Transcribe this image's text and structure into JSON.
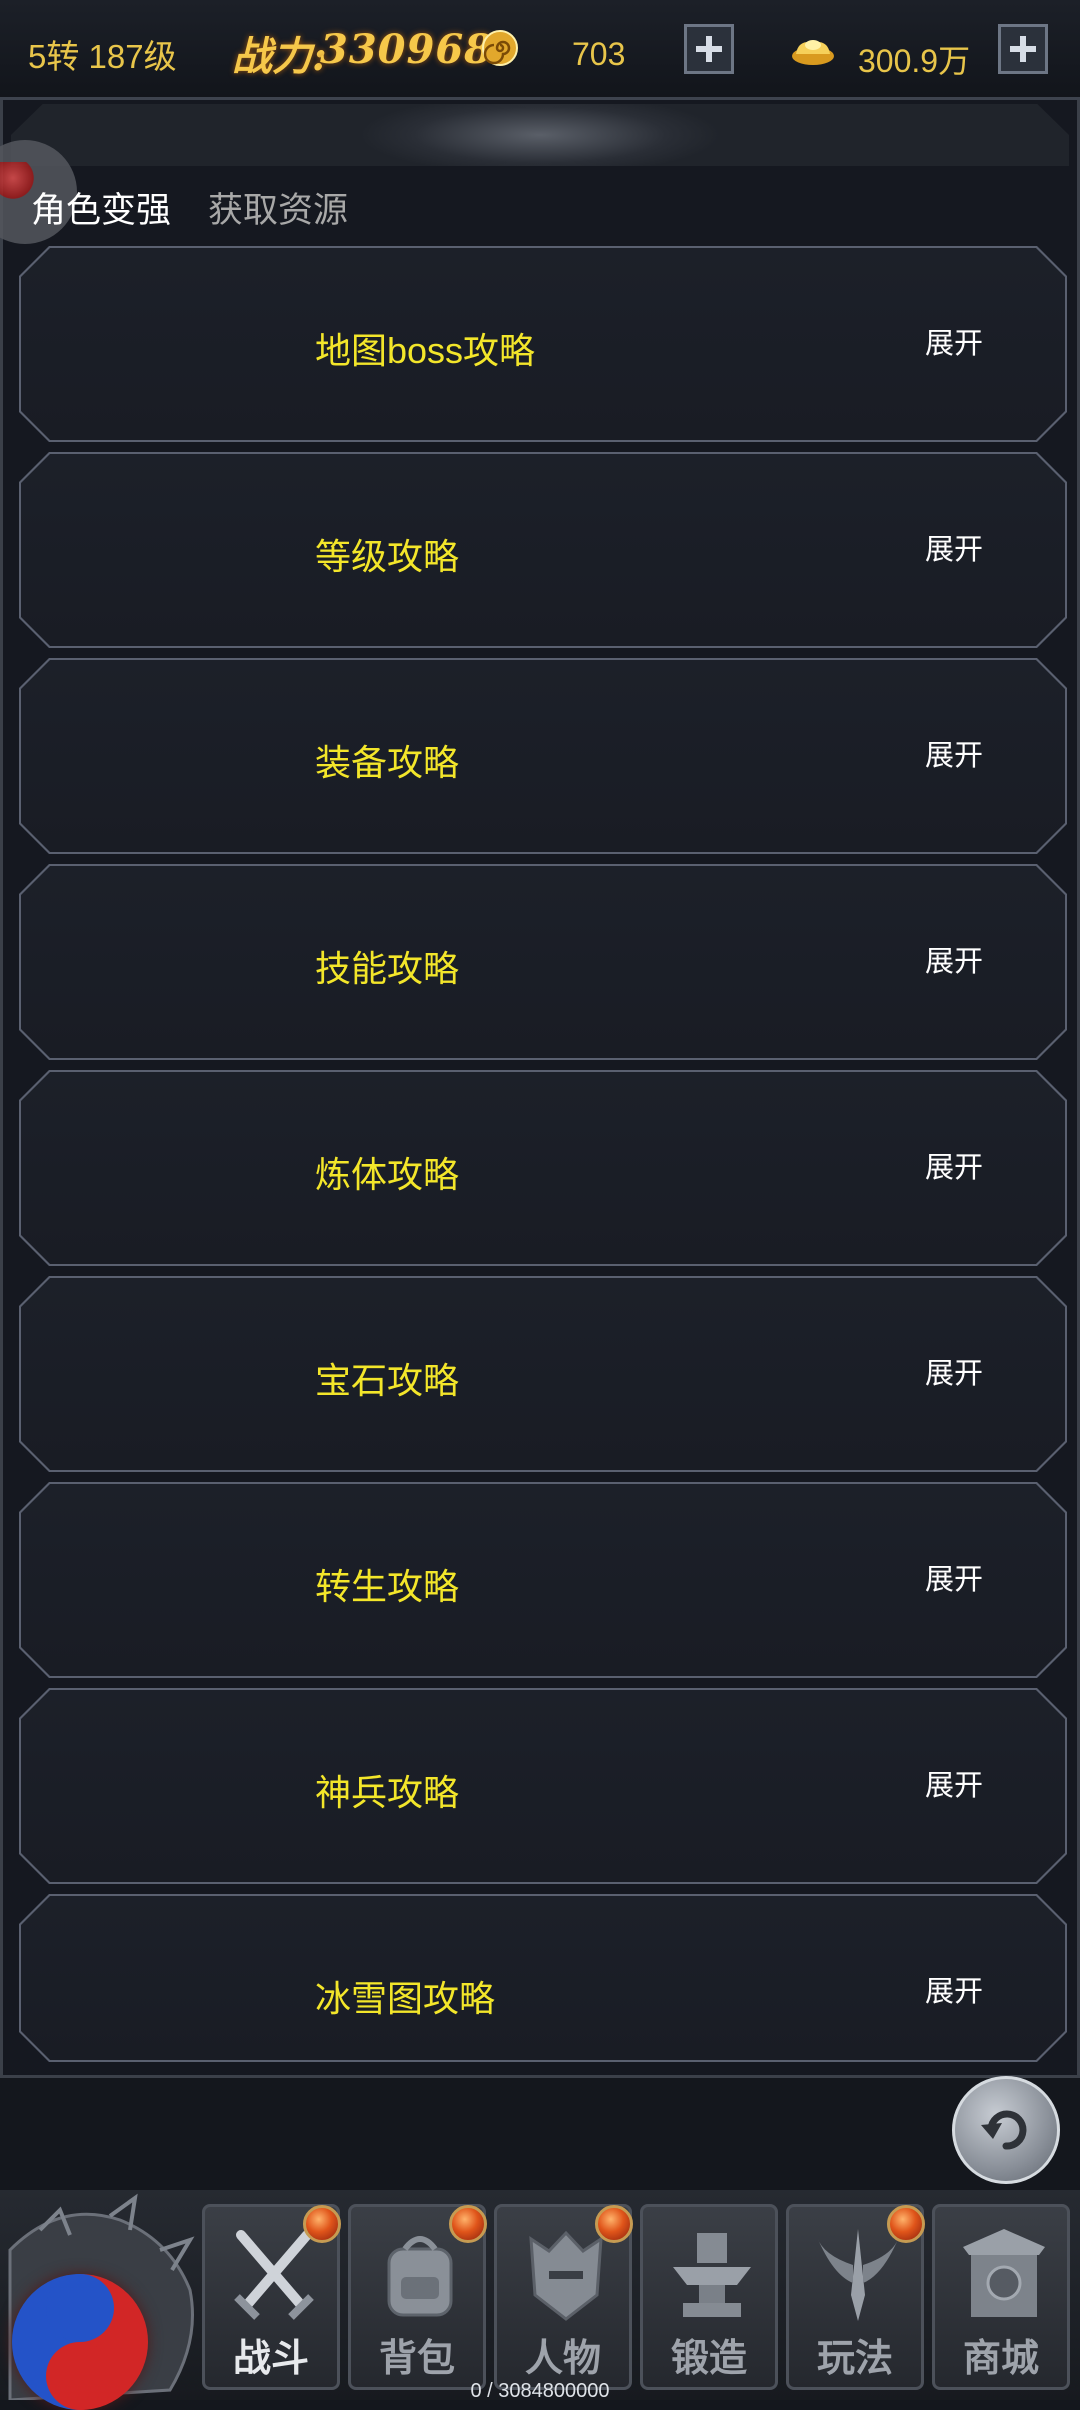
{
  "topbar": {
    "level": "5转 187级",
    "power_label": "战力:",
    "power_value": "330968",
    "currency1_icon": "spiral-coin-icon",
    "currency1": "703",
    "currency2_icon": "gold-ingot-icon",
    "currency2": "300.9万"
  },
  "tabs": [
    {
      "label": "角色变强",
      "active": true
    },
    {
      "label": "获取资源",
      "active": false
    }
  ],
  "guides": [
    {
      "title": "地图boss攻略",
      "action": "展开"
    },
    {
      "title": "等级攻略",
      "action": "展开"
    },
    {
      "title": "装备攻略",
      "action": "展开"
    },
    {
      "title": "技能攻略",
      "action": "展开"
    },
    {
      "title": "炼体攻略",
      "action": "展开"
    },
    {
      "title": "宝石攻略",
      "action": "展开"
    },
    {
      "title": "转生攻略",
      "action": "展开"
    },
    {
      "title": "神兵攻略",
      "action": "展开"
    },
    {
      "title": "冰雪图攻略",
      "action": "展开"
    }
  ],
  "nav": [
    {
      "label": "战斗",
      "icon": "crossed-swords-icon",
      "badge": true,
      "active": true
    },
    {
      "label": "背包",
      "icon": "backpack-icon",
      "badge": true,
      "active": false
    },
    {
      "label": "人物",
      "icon": "helmet-icon",
      "badge": true,
      "active": false
    },
    {
      "label": "锻造",
      "icon": "anvil-icon",
      "badge": false,
      "active": false
    },
    {
      "label": "玩法",
      "icon": "winged-sword-icon",
      "badge": true,
      "active": false
    },
    {
      "label": "商城",
      "icon": "shop-gate-icon",
      "badge": false,
      "active": false
    }
  ],
  "experience": "0 / 3084800000",
  "colors": {
    "accent_gold": "#e8c54a",
    "guide_title_yellow": "#f3e62a",
    "badge_orange": "#e0551a"
  }
}
